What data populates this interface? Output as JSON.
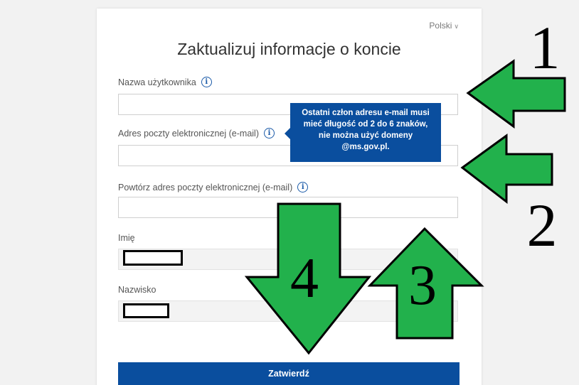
{
  "language": {
    "label": "Polski",
    "chevron_icon": "chevron-down-icon"
  },
  "form": {
    "title": "Zaktualizuj informacje o koncie",
    "fields": {
      "username": {
        "label": "Nazwa użytkownika",
        "value": ""
      },
      "email": {
        "label": "Adres poczty elektronicznej (e-mail)",
        "value": ""
      },
      "email_repeat": {
        "label": "Powtórz adres poczty elektronicznej (e-mail)",
        "value": ""
      },
      "first_name": {
        "label": "Imię"
      },
      "last_name": {
        "label": "Nazwisko"
      }
    },
    "tooltip": {
      "lines": [
        "Ostatni człon adresu e-mail musi",
        "mieć długość od 2 do 6 znaków,",
        "nie można użyć domeny",
        "@ms.gov.pl."
      ]
    },
    "submit_label": "Zatwierdź"
  },
  "annotations": {
    "arrow_color": "#22b14c",
    "numbers": [
      "1",
      "2",
      "3",
      "4"
    ]
  },
  "colors": {
    "primary": "#0a4e9e",
    "info_icon": "#1a5aa8"
  }
}
